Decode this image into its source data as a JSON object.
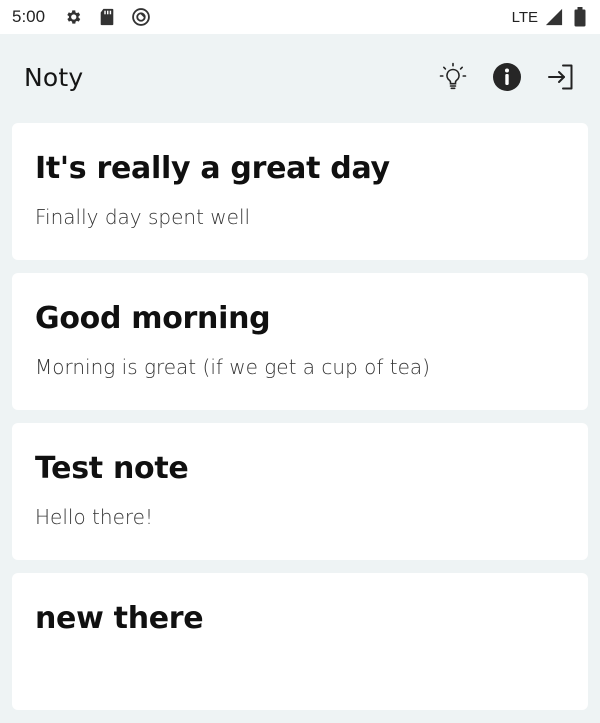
{
  "status_bar": {
    "time": "5:00",
    "network": "LTE",
    "icons": [
      "gear-icon",
      "sd-card-icon",
      "sync-icon",
      "signal-icon",
      "battery-icon"
    ]
  },
  "app_bar": {
    "title": "Noty",
    "actions": [
      "lightbulb-icon",
      "info-icon",
      "logout-icon"
    ]
  },
  "notes": [
    {
      "title": "It's really a great day",
      "body": "Finally day spent well"
    },
    {
      "title": "Good morning",
      "body": "Morning is great (if we get a cup of tea)"
    },
    {
      "title": "Test note",
      "body": "Hello there!"
    },
    {
      "title": "new there",
      "body": ""
    }
  ],
  "colors": {
    "background": "#eef3f4",
    "card": "#ffffff",
    "text": "#101010"
  }
}
